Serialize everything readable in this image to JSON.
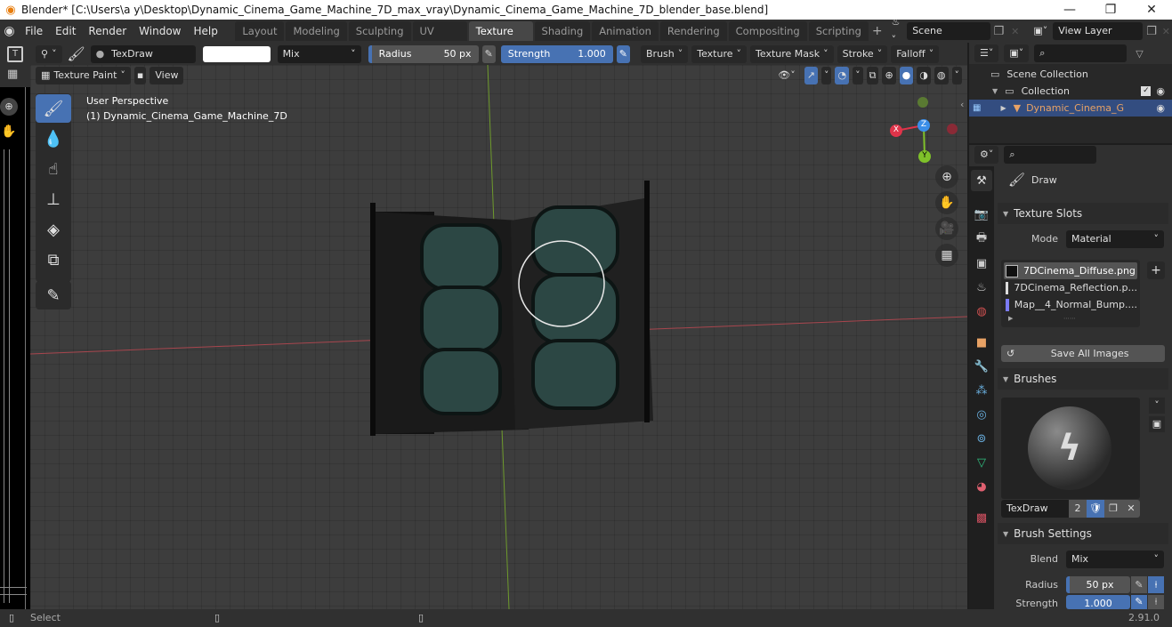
{
  "window": {
    "title": "Blender* [C:\\Users\\a y\\Desktop\\Dynamic_Cinema_Game_Machine_7D_max_vray\\Dynamic_Cinema_Game_Machine_7D_blender_base.blend]",
    "minimize": "—",
    "maximize": "❐",
    "close": "✕"
  },
  "menu": [
    "File",
    "Edit",
    "Render",
    "Window",
    "Help"
  ],
  "workspaces": [
    {
      "label": "Layout",
      "active": false
    },
    {
      "label": "Modeling",
      "active": false
    },
    {
      "label": "Sculpting",
      "active": false
    },
    {
      "label": "UV Editing",
      "active": false
    },
    {
      "label": "Texture Paint",
      "active": true
    },
    {
      "label": "Shading",
      "active": false
    },
    {
      "label": "Animation",
      "active": false
    },
    {
      "label": "Rendering",
      "active": false
    },
    {
      "label": "Compositing",
      "active": false
    },
    {
      "label": "Scripting",
      "active": false
    }
  ],
  "add_workspace": "+",
  "scene": {
    "name": "Scene"
  },
  "view_layer": {
    "name": "View Layer"
  },
  "tool_header": {
    "brush_name": "TexDraw",
    "blend": "Mix",
    "radius_label": "Radius",
    "radius_value": "50 px",
    "strength_label": "Strength",
    "strength_value": "1.000",
    "strength_fraction": 1.0,
    "menus": [
      "Brush",
      "Texture",
      "Texture Mask",
      "Stroke",
      "Falloff"
    ]
  },
  "viewport": {
    "mode": "Texture Paint",
    "view_menu": "View",
    "perspective": "User Perspective",
    "object_label": "(1) Dynamic_Cinema_Game_Machine_7D",
    "gizmo": {
      "x": "X",
      "y": "Y",
      "z": "Z"
    }
  },
  "outliner": {
    "items": [
      {
        "label": "Scene Collection",
        "level": 0
      },
      {
        "label": "Collection",
        "level": 1
      },
      {
        "label": "Dynamic_Cinema_G",
        "level": 2,
        "selected": true
      }
    ]
  },
  "properties": {
    "tool_name": "Draw",
    "texture_slots": {
      "header": "Texture Slots",
      "mode_label": "Mode",
      "mode_value": "Material",
      "slots": [
        "7DCinema_Diffuse.png",
        "7DCinema_Reflection.p...",
        "Map__4_Normal_Bump...."
      ],
      "save_all": "Save All Images"
    },
    "brushes": {
      "header": "Brushes",
      "brush_name": "TexDraw",
      "users": "2"
    },
    "brush_settings": {
      "header": "Brush Settings",
      "blend_label": "Blend",
      "blend_value": "Mix",
      "radius_label": "Radius",
      "radius_value": "50 px",
      "strength_label": "Strength",
      "strength_value": "1.000"
    }
  },
  "status": {
    "select": "Select",
    "version": "2.91.0"
  },
  "colors": {
    "accent": "#4772b3",
    "selected_row": "#334d80",
    "object_orange": "#e8a265",
    "axis_x": "#e0344a",
    "axis_y": "#7fc12a",
    "axis_z": "#3b8ee8"
  }
}
